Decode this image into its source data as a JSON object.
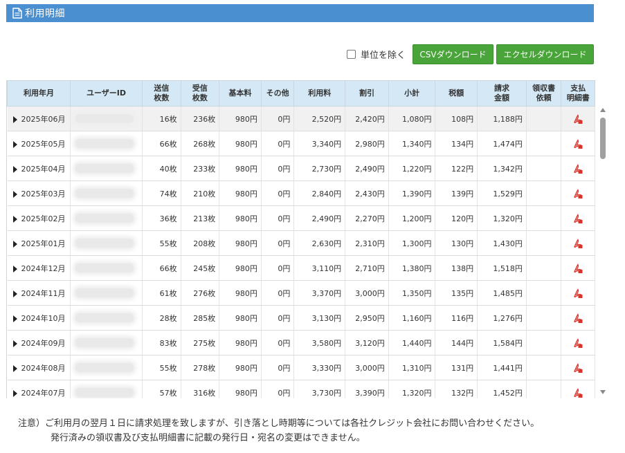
{
  "header": {
    "title": "利用明細",
    "icon": "document-icon"
  },
  "toolbar": {
    "exclude_units_label": "単位を除く",
    "exclude_units_checked": false,
    "csv_button": "CSVダウンロード",
    "excel_button": "エクセルダウンロード"
  },
  "table": {
    "columns": [
      [
        "利用年月"
      ],
      [
        "ユーザーID"
      ],
      [
        "送信",
        "枚数"
      ],
      [
        "受信",
        "枚数"
      ],
      [
        "基本料"
      ],
      [
        "その他"
      ],
      [
        "利用料"
      ],
      [
        "割引"
      ],
      [
        "小計"
      ],
      [
        "税額"
      ],
      [
        "請求",
        "金額"
      ],
      [
        "領収書",
        "依頼"
      ],
      [
        "支払",
        "明細書"
      ]
    ],
    "rows": [
      {
        "ym": "2025年06月",
        "sent": "16枚",
        "recv": "236枚",
        "base": "980円",
        "other": "0円",
        "usage": "2,520円",
        "discount": "2,420円",
        "subtotal": "1,080円",
        "tax": "108円",
        "total": "1,188円"
      },
      {
        "ym": "2025年05月",
        "sent": "66枚",
        "recv": "268枚",
        "base": "980円",
        "other": "0円",
        "usage": "3,340円",
        "discount": "2,980円",
        "subtotal": "1,340円",
        "tax": "134円",
        "total": "1,474円"
      },
      {
        "ym": "2025年04月",
        "sent": "40枚",
        "recv": "233枚",
        "base": "980円",
        "other": "0円",
        "usage": "2,730円",
        "discount": "2,490円",
        "subtotal": "1,220円",
        "tax": "122円",
        "total": "1,342円"
      },
      {
        "ym": "2025年03月",
        "sent": "74枚",
        "recv": "210枚",
        "base": "980円",
        "other": "0円",
        "usage": "2,840円",
        "discount": "2,430円",
        "subtotal": "1,390円",
        "tax": "139円",
        "total": "1,529円"
      },
      {
        "ym": "2025年02月",
        "sent": "36枚",
        "recv": "213枚",
        "base": "980円",
        "other": "0円",
        "usage": "2,490円",
        "discount": "2,270円",
        "subtotal": "1,200円",
        "tax": "120円",
        "total": "1,320円"
      },
      {
        "ym": "2025年01月",
        "sent": "55枚",
        "recv": "208枚",
        "base": "980円",
        "other": "0円",
        "usage": "2,630円",
        "discount": "2,310円",
        "subtotal": "1,300円",
        "tax": "130円",
        "total": "1,430円"
      },
      {
        "ym": "2024年12月",
        "sent": "66枚",
        "recv": "245枚",
        "base": "980円",
        "other": "0円",
        "usage": "3,110円",
        "discount": "2,710円",
        "subtotal": "1,380円",
        "tax": "138円",
        "total": "1,518円"
      },
      {
        "ym": "2024年11月",
        "sent": "61枚",
        "recv": "276枚",
        "base": "980円",
        "other": "0円",
        "usage": "3,370円",
        "discount": "3,000円",
        "subtotal": "1,350円",
        "tax": "135円",
        "total": "1,485円"
      },
      {
        "ym": "2024年10月",
        "sent": "28枚",
        "recv": "285枚",
        "base": "980円",
        "other": "0円",
        "usage": "3,130円",
        "discount": "2,950円",
        "subtotal": "1,160円",
        "tax": "116円",
        "total": "1,276円"
      },
      {
        "ym": "2024年09月",
        "sent": "83枚",
        "recv": "275枚",
        "base": "980円",
        "other": "0円",
        "usage": "3,580円",
        "discount": "3,120円",
        "subtotal": "1,440円",
        "tax": "144円",
        "total": "1,584円"
      },
      {
        "ym": "2024年08月",
        "sent": "55枚",
        "recv": "278枚",
        "base": "980円",
        "other": "0円",
        "usage": "3,330円",
        "discount": "3,000円",
        "subtotal": "1,310円",
        "tax": "131円",
        "total": "1,441円"
      },
      {
        "ym": "2024年07月",
        "sent": "57枚",
        "recv": "316枚",
        "base": "980円",
        "other": "0円",
        "usage": "3,730円",
        "discount": "3,390円",
        "subtotal": "1,320円",
        "tax": "132円",
        "total": "1,452円"
      }
    ],
    "pdf_icon": "pdf-icon",
    "expand_icon": "expand-arrow-icon"
  },
  "notes": {
    "line1": "注意）ご利用月の翌月１日に請求処理を致しますが、引き落とし時期等については各社クレジット会社にお問い合わせください。",
    "line2": "発行済みの領収書及び支払明細書に記載の発行日・宛名の変更はできません。"
  },
  "colors": {
    "title_bar": "#4a8fd0",
    "header_bg": "#d5e8f5",
    "button_green": "#49a53a",
    "pdf_red": "#d9342b"
  }
}
